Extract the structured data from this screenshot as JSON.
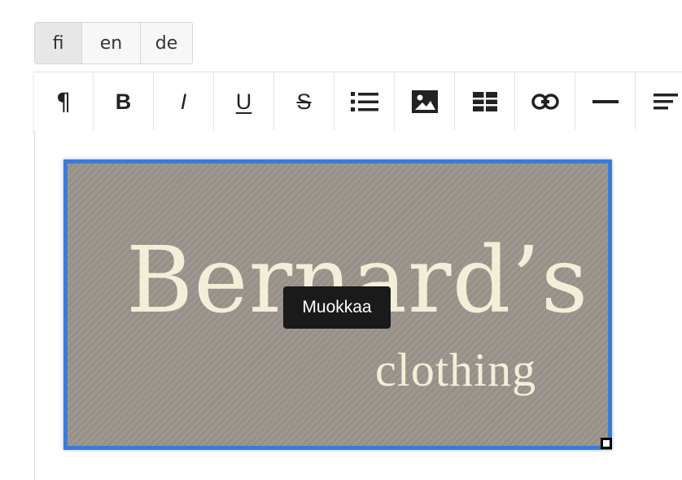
{
  "languages": {
    "tabs": [
      "fi",
      "en",
      "de"
    ],
    "active": "fi"
  },
  "toolbar": {
    "buttons": [
      {
        "name": "paragraph",
        "icon": "pilcrow-icon",
        "glyph": "¶"
      },
      {
        "name": "bold",
        "icon": "bold-icon",
        "glyph": "B"
      },
      {
        "name": "italic",
        "icon": "italic-icon",
        "glyph": "I"
      },
      {
        "name": "underline",
        "icon": "underline-icon",
        "glyph": "U"
      },
      {
        "name": "strikethrough",
        "icon": "strikethrough-icon",
        "glyph": "S"
      },
      {
        "name": "bullet-list",
        "icon": "list-icon"
      },
      {
        "name": "image",
        "icon": "image-icon"
      },
      {
        "name": "table",
        "icon": "table-icon"
      },
      {
        "name": "link",
        "icon": "link-icon"
      },
      {
        "name": "horizontal-rule",
        "icon": "horizontal-rule-icon"
      },
      {
        "name": "align",
        "icon": "align-left-icon"
      }
    ]
  },
  "image": {
    "logo_main": "Bernard’s",
    "logo_sub": "clothing",
    "background_color": "#9b948d",
    "text_color": "#f4eed8",
    "selection_color": "#3b7bd6"
  },
  "tooltip": {
    "label": "Muokkaa"
  }
}
